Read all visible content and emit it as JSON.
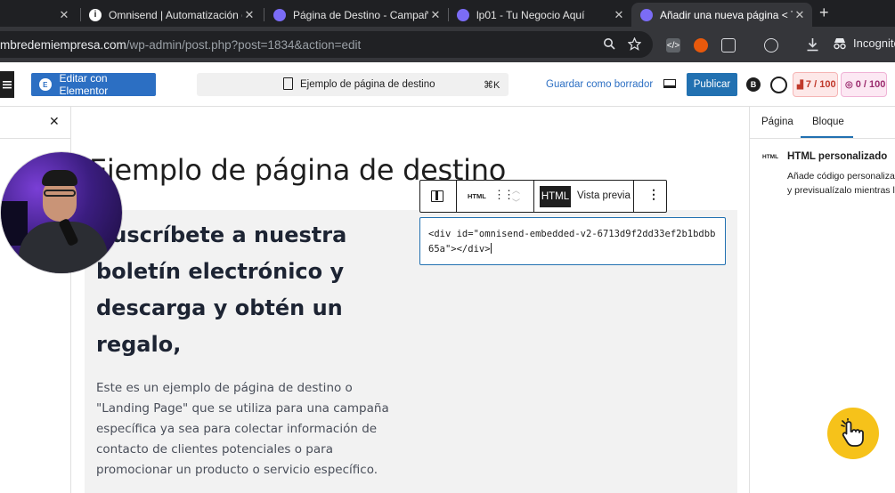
{
  "browser": {
    "tabs": [
      {
        "title": "",
        "active": false
      },
      {
        "title": "Omnisend | Automatización d",
        "active": false
      },
      {
        "title": "Página de Destino - Campaña",
        "active": false
      },
      {
        "title": "lp01 - Tu Negocio Aquí",
        "active": false
      },
      {
        "title": "Añadir una nueva página < Tu",
        "active": true
      }
    ],
    "new_tab": "+",
    "close_glyph": "✕",
    "url_host": "mbredemiempresa.com",
    "url_path": "/wp-admin/post.php?post=1834&action=edit",
    "profile_label": "Incognito"
  },
  "editor": {
    "elementor_label": "Editar con Elementor",
    "document_title": "Ejemplo de página de destino",
    "shortcut": "⌘K",
    "save_draft": "Guardar como borrador",
    "publish": "Publicar",
    "seo_score": "7 / 100",
    "readability_score": "0 / 100"
  },
  "left_panel": {
    "close_glyph": "✕"
  },
  "canvas": {
    "page_title": "Ejemplo de página de destino",
    "heading": "Suscríbete a nuestra boletín electrónico y descarga y obtén un regalo,",
    "paragraph": "Este es un ejemplo de página de destino o \"Landing Page\" que se utiliza para una campaña específica ya sea para colectar información de contacto de clientes potenciales o para promocionar un producto o servicio específico."
  },
  "block_toolbar": {
    "html_icon_text": "HTML",
    "html_tab": "HTML",
    "preview_tab": "Vista previa",
    "more_glyph": "⋮"
  },
  "code_block": {
    "content": "<div id=\"omnisend-embedded-v2-6713d9f2dd33ef2b1bdbb65a\"></div>"
  },
  "sidebar": {
    "tab_page": "Página",
    "tab_block": "Bloque",
    "icon_text": "HTML",
    "block_title": "HTML personalizado",
    "block_desc_line1": "Añade código personaliza",
    "block_desc_line2": "y previsualízalo mientras l"
  },
  "colors": {
    "accent": "#2271b1",
    "elementor": "#2c6fc3",
    "seo_bg": "#fde8e8",
    "seo_text": "#c0392b",
    "readability_text": "#9b2c6e",
    "cursor_badge": "#f6c21a"
  }
}
